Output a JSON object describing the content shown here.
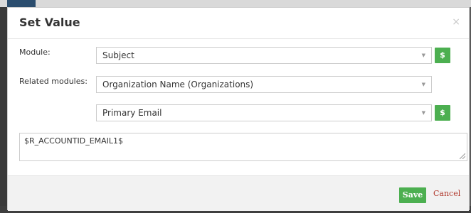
{
  "modal": {
    "title": "Set Value",
    "close_symbol": "×"
  },
  "fields": {
    "module_label": "Module:",
    "module_value": "Subject",
    "related_label": "Related modules:",
    "related_value": "Organization Name (Organizations)",
    "field_value": "Primary Email",
    "dollar_label": "$",
    "caret_symbol": "▼"
  },
  "expression": {
    "value": "$R_ACCOUNTID_EMAIL1$"
  },
  "footer": {
    "save_label": "Save",
    "cancel_label": "Cancel"
  },
  "colors": {
    "accent_green": "#4caf50",
    "cancel_red": "#b13a2e"
  }
}
